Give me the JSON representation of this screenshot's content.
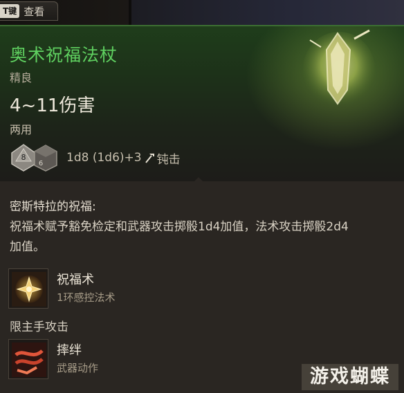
{
  "top_bar": {
    "key": "T键",
    "action": "查看"
  },
  "item": {
    "name": "奥术祝福法杖",
    "rarity": "精良",
    "damage": "4~11伤害",
    "handedness": "两用",
    "dice_face_1": "8",
    "dice_face_2": "6",
    "dice_formula": "1d8 (1d6)+3",
    "damage_type": "钝击",
    "colors": {
      "name": "#5fd060",
      "header_green": "#1f3d1b"
    }
  },
  "passive": {
    "title": "密斯特拉的祝福:",
    "description": "祝福术赋予豁免检定和武器攻击掷骰1d4加值，法术攻击掷骰2d4加值。"
  },
  "abilities": [
    {
      "name": "祝福术",
      "subtitle": "1环感控法术",
      "icon": "bless-spell-icon"
    },
    {
      "name": "摔绊",
      "subtitle": "武器动作",
      "icon": "topple-action-icon"
    }
  ],
  "mainhand_label": "限主手攻击",
  "watermark": "游戏蝴蝶"
}
